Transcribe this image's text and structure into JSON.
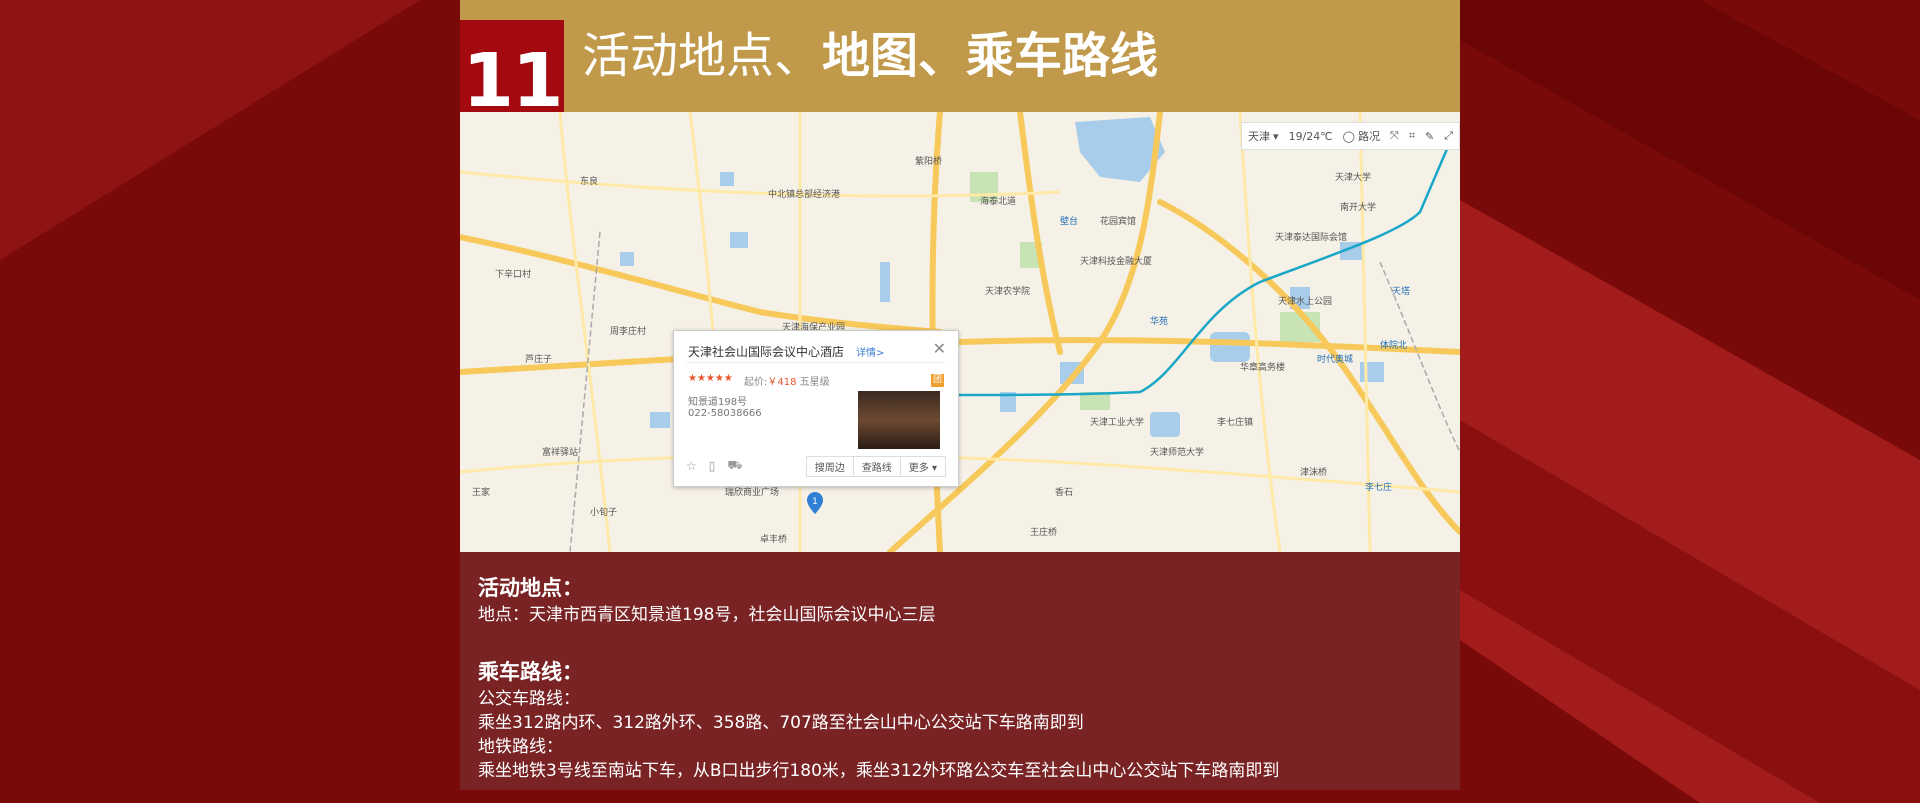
{
  "header": {
    "number": "11",
    "title_plain": "活动地点、",
    "title_bold": "地图、乘车路线"
  },
  "map": {
    "toolbar": {
      "city": "天津",
      "weather": "19/24℃",
      "traffic": "路况"
    },
    "popup": {
      "name": "天津社会山国际会议中心酒店",
      "detail": "详情>",
      "rating": "★★★★★",
      "price_label": "起价:",
      "price": "￥418",
      "level": "五星级",
      "address": "知景道198号",
      "phone": "022-58038666",
      "btn_nearby": "搜周边",
      "btn_route": "查路线",
      "btn_more": "更多 ▾",
      "tag": "团"
    },
    "labels": [
      "紫阳桥",
      "海泰北道",
      "花园宾馆",
      "天津科技金融大厦",
      "天津大学",
      "南开大学",
      "天津泰达国际会馆",
      "天津农学院",
      "华苑",
      "天津水上公园",
      "天塔",
      "华章高务楼",
      "时代奥城",
      "体院北",
      "天津工业大学",
      "李七庄镇",
      "天津师范大学",
      "津沫桥",
      "李七庄",
      "中北镇总部经济港",
      "天津海保产业园",
      "周李庄村",
      "王家",
      "小旬子",
      "东良",
      "下辛口村",
      "芦庄子",
      "瑞欣商业广场",
      "卓丰桥",
      "王庄桥",
      "香石",
      "壁台",
      "富祥驿站"
    ],
    "pin_label": "1"
  },
  "info": {
    "location_heading": "活动地点：",
    "location_text": "地点：天津市西青区知景道198号，社会山国际会议中心三层",
    "route_heading": "乘车路线：",
    "bus_label": "公交车路线：",
    "bus_text": "乘坐312路内环、312路外环、358路、707路至社会山中心公交站下车路南即到",
    "metro_label": "地铁路线：",
    "metro_text": "乘坐地铁3号线至南站下车，从B口出步行180米，乘坐312外环路公交车至社会山中心公交站下车路南即到"
  },
  "colors": {
    "background": "#7a0a0a",
    "header": "#c0994a",
    "badge": "#a3090f",
    "info_overlay": "#782628"
  }
}
